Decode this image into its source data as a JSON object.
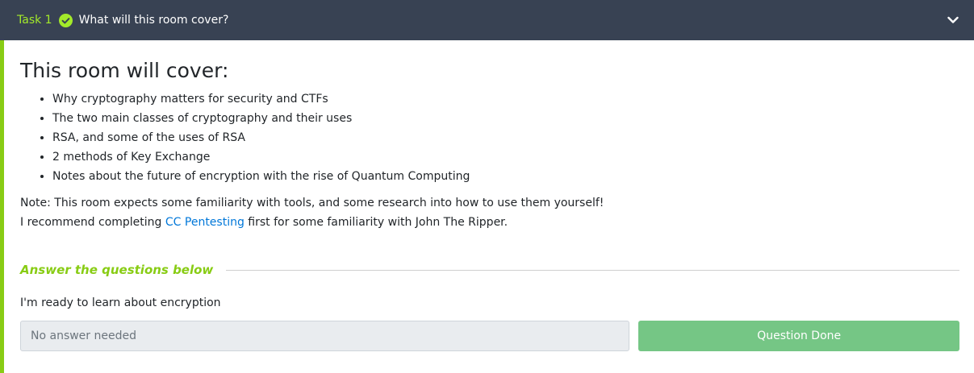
{
  "task": {
    "number": "Task 1",
    "title": "What will this room cover?",
    "status_icon": "check-circle-icon",
    "toggle_icon": "chevron-down-icon"
  },
  "content": {
    "heading": "This room will cover:",
    "items": [
      "Why cryptography matters for security and CTFs",
      "The two main classes of cryptography and their uses",
      "RSA, and some of the uses of RSA",
      "2 methods of Key Exchange",
      "Notes about the future of encryption with the rise of Quantum Computing"
    ],
    "note_line1": "Note: This room expects some familiarity with tools, and some research into how to use them yourself!",
    "note_line2_before": "I recommend completing ",
    "note_link": "CC Pentesting",
    "note_line2_after": " first for some familiarity with John The Ripper."
  },
  "answers": {
    "section_title": "Answer the questions below",
    "question": "I'm ready to learn about encryption",
    "input_placeholder": "No answer needed",
    "button_label": "Question Done"
  },
  "colors": {
    "header_bg": "#384253",
    "accent_green": "#88cc14",
    "task_number": "#a3ea2a",
    "button_green": "#75c685",
    "link_blue": "#0077d9"
  }
}
